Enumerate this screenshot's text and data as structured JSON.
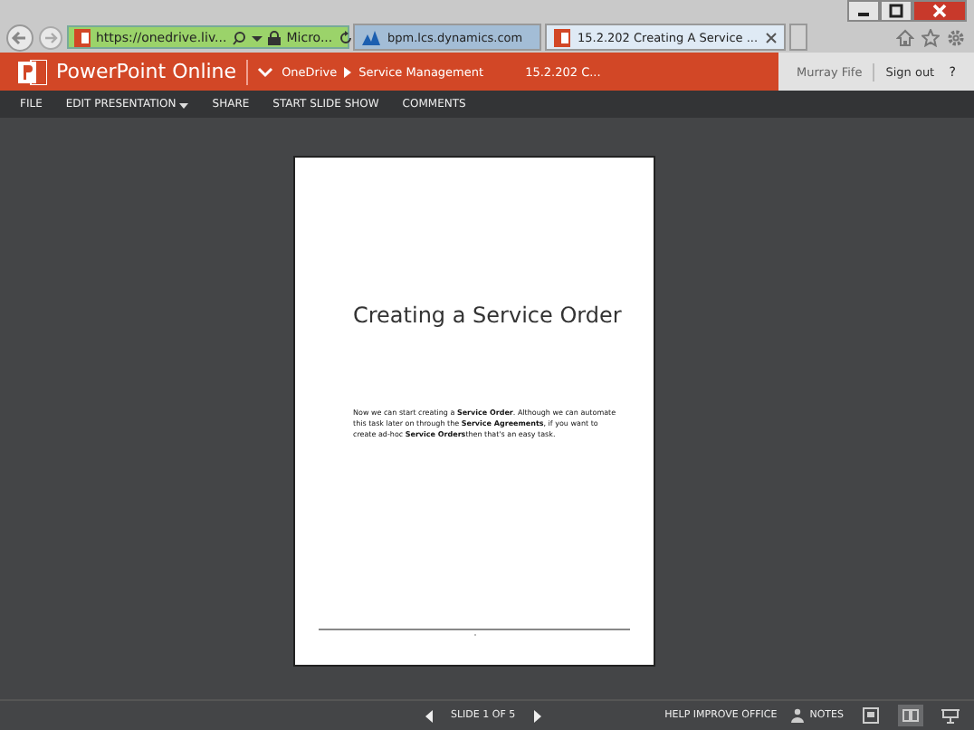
{
  "browser": {
    "address": "https://onedrive.liv...",
    "site_label": "Micro...",
    "tabs": [
      {
        "label": "bpm.lcs.dynamics.com",
        "selected": false
      },
      {
        "label": "15.2.202 Creating A Service ...",
        "selected": true
      }
    ]
  },
  "app_bar": {
    "title": "PowerPoint Online",
    "breadcrumb": [
      "OneDrive",
      "Service Management"
    ],
    "file_name": "15.2.202 C...",
    "user": "Murray Fife",
    "sign_out": "Sign out",
    "help": "?"
  },
  "menu": [
    "FILE",
    "EDIT PRESENTATION",
    "SHARE",
    "START SLIDE SHOW",
    "COMMENTS"
  ],
  "slide": {
    "title": "Creating a Service Order",
    "body": "Now we can start creating a **Service Order**. Although we can automate this task later on through the **Service Agreements**, if you want to create ad-hoc **Service Orders**then that's an easy task."
  },
  "status_bar": {
    "slide_counter": "SLIDE 1 OF 5",
    "help": "HELP IMPROVE OFFICE",
    "notes": "NOTES",
    "views": [
      {
        "kind": "normal",
        "selected": false
      },
      {
        "kind": "reading",
        "selected": true
      },
      {
        "kind": "slideshow",
        "selected": false
      }
    ]
  }
}
